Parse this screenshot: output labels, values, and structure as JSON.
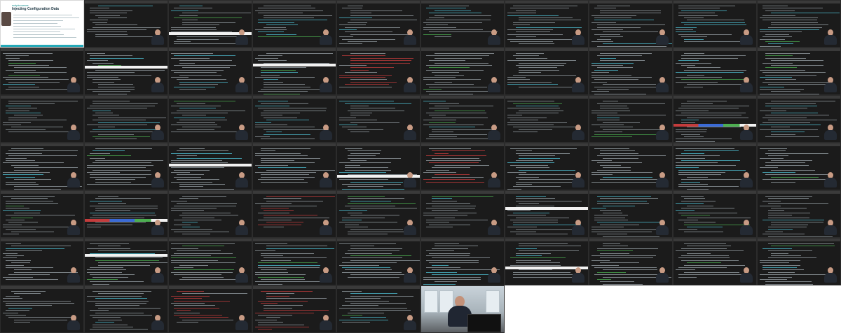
{
  "page": {
    "columns": 10,
    "rows": 7,
    "background": "#ffffff"
  },
  "first_slide": {
    "brand": "scriptcourses",
    "title": "Injecting Configuration Data"
  },
  "tiles": [
    "slide",
    "terminal",
    "terminal-light",
    "terminal",
    "terminal",
    "terminal",
    "terminal",
    "terminal",
    "terminal",
    "terminal",
    "terminal",
    "terminal-light",
    "terminal",
    "terminal-light",
    "terminal-red",
    "terminal",
    "terminal",
    "terminal",
    "terminal",
    "terminal",
    "terminal",
    "terminal",
    "terminal",
    "terminal",
    "terminal",
    "terminal",
    "terminal",
    "terminal",
    "terminal-colorbar",
    "terminal",
    "terminal",
    "terminal",
    "terminal-light",
    "terminal",
    "terminal-light",
    "terminal-red",
    "terminal",
    "terminal",
    "terminal",
    "terminal",
    "terminal",
    "terminal-colorbar",
    "terminal",
    "terminal-red",
    "terminal",
    "terminal",
    "terminal-light",
    "terminal",
    "terminal",
    "terminal",
    "terminal",
    "terminal-light",
    "terminal",
    "terminal",
    "terminal",
    "terminal",
    "terminal-light",
    "terminal",
    "terminal",
    "terminal",
    "terminal",
    "terminal",
    "terminal-red",
    "terminal-red",
    "terminal",
    "office",
    "empty",
    "empty",
    "empty",
    "empty"
  ],
  "colors": {
    "terminal_bg": "#1b1b1b",
    "code_text": "#9aa3a8",
    "code_accent": "#4fc1d6",
    "code_red": "#c43c3c",
    "code_green": "#4caf50",
    "light_bar": "#f2f2f2",
    "slide_accent": "#25a9b8"
  }
}
